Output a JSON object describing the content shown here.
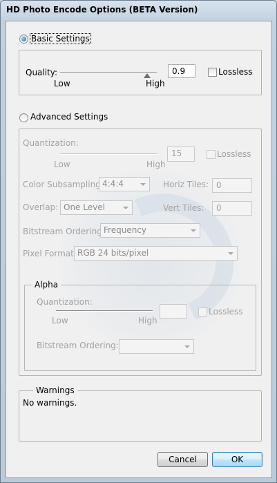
{
  "window": {
    "title": "HD Photo Encode Options (BETA Version)"
  },
  "basic": {
    "label": "Basic Settings",
    "selected": true,
    "quality_label": "Quality:",
    "low": "Low",
    "high": "High",
    "quality_value": "0.9",
    "lossless_label": "Lossless",
    "lossless_checked": false
  },
  "advanced": {
    "label": "Advanced Settings",
    "selected": false,
    "quantization_label": "Quantization:",
    "low": "Low",
    "high": "High",
    "quantization_value": "15",
    "lossless_label": "Lossless",
    "color_subsampling_label": "Color Subsampling:",
    "color_subsampling_value": "4:4:4",
    "horiz_tiles_label": "Horiz Tiles:",
    "horiz_tiles_value": "0",
    "overlap_label": "Overlap:",
    "overlap_value": "One Level",
    "vert_tiles_label": "Vert Tiles:",
    "vert_tiles_value": "0",
    "bitstream_label": "Bitstream Ordering:",
    "bitstream_value": "Frequency",
    "pixel_format_label": "Pixel Format:",
    "pixel_format_value": "RGB 24 bits/pixel"
  },
  "alpha": {
    "label": "Alpha",
    "quantization_label": "Quantization:",
    "low": "Low",
    "high": "High",
    "quantization_value": "",
    "lossless_label": "Lossless",
    "bitstream_label": "Bitstream Ordering:",
    "bitstream_value": ""
  },
  "warnings": {
    "label": "Warnings",
    "text": "No warnings."
  },
  "buttons": {
    "cancel": "Cancel",
    "ok": "OK"
  }
}
